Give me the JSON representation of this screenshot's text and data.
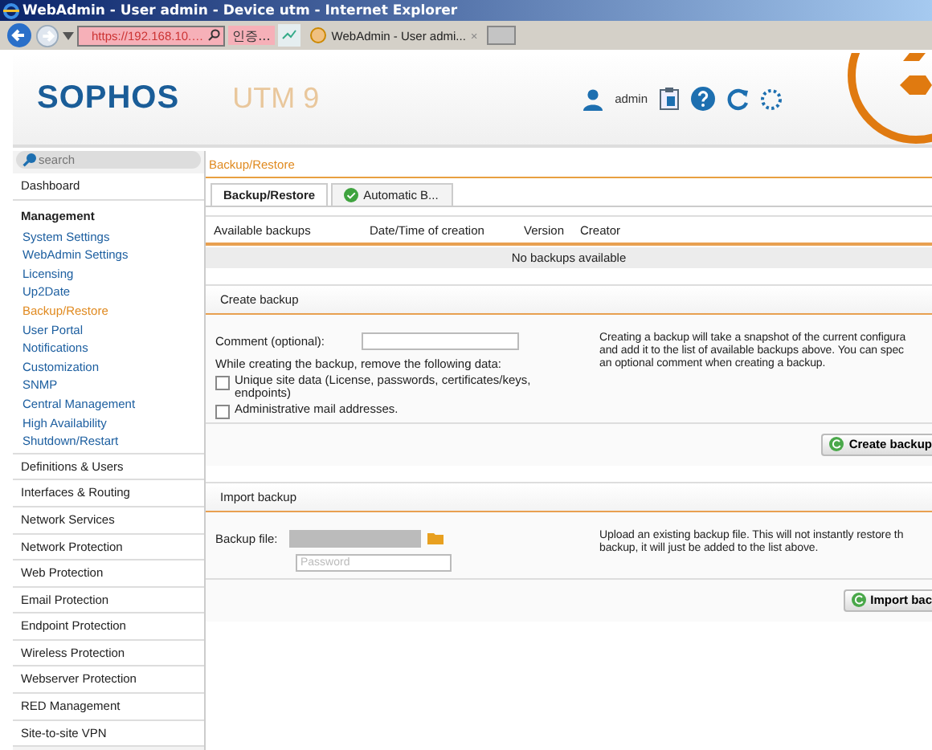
{
  "window": {
    "title": "WebAdmin - User admin - Device utm - Internet Explorer"
  },
  "browser": {
    "address": "https://192.168.10.…",
    "cert_warning": "인증...",
    "tab": "WebAdmin - User admi...",
    "tab_close": "×"
  },
  "header": {
    "logo": "SOPHOS",
    "product": "UTM 9",
    "user": "admin"
  },
  "sidebar": {
    "search_placeholder": "search",
    "items": [
      {
        "label": "Dashboard",
        "kind": "category"
      },
      {
        "label": "Management",
        "kind": "group",
        "children": [
          {
            "label": "System Settings",
            "selected": false
          },
          {
            "label": "WebAdmin Settings",
            "selected": false
          },
          {
            "label": "Licensing",
            "selected": false
          },
          {
            "label": "Up2Date",
            "selected": false
          },
          {
            "label": "Backup/Restore",
            "selected": true
          },
          {
            "label": "User Portal",
            "selected": false
          },
          {
            "label": "Notifications",
            "selected": false
          },
          {
            "label": "Customization",
            "selected": false
          },
          {
            "label": "SNMP",
            "selected": false
          },
          {
            "label": "Central Management",
            "selected": false
          },
          {
            "label": "High Availability",
            "selected": false
          },
          {
            "label": "Shutdown/Restart",
            "selected": false
          }
        ]
      },
      {
        "label": "Definitions & Users",
        "kind": "category"
      },
      {
        "label": "Interfaces & Routing",
        "kind": "category"
      },
      {
        "label": "Network Services",
        "kind": "category"
      },
      {
        "label": "Network Protection",
        "kind": "category"
      },
      {
        "label": "Web Protection",
        "kind": "category"
      },
      {
        "label": "Email Protection",
        "kind": "category"
      },
      {
        "label": "Endpoint Protection",
        "kind": "category"
      },
      {
        "label": "Wireless Protection",
        "kind": "category"
      },
      {
        "label": "Webserver Protection",
        "kind": "category"
      },
      {
        "label": "RED Management",
        "kind": "category"
      },
      {
        "label": "Site-to-site VPN",
        "kind": "category"
      }
    ]
  },
  "breadcrumb": "Backup/Restore",
  "tabs": [
    {
      "label": "Backup/Restore",
      "selected": true,
      "status_ok": false
    },
    {
      "label": "Automatic B...",
      "selected": false,
      "status_ok": true
    }
  ],
  "table": {
    "columns": [
      "Available backups",
      "Date/Time of creation",
      "Version",
      "Creator"
    ],
    "empty_text": "No backups available"
  },
  "create_backup": {
    "title": "Create backup",
    "comment_label": "Comment (optional):",
    "remove_label": "While creating the backup, remove the following data:",
    "options": [
      {
        "label": "Unique site data (License, passwords, certificates/keys, endpoints)",
        "checked": false
      },
      {
        "label": "Administrative mail addresses.",
        "checked": false
      }
    ],
    "help_lines": [
      "Creating a backup will take a snapshot of the current configura",
      "and add it to the list of available backups above. You can spec",
      "an optional comment when creating a backup."
    ],
    "button": "Create backup"
  },
  "import_backup": {
    "title": "Import backup",
    "file_label": "Backup file:",
    "password_placeholder": "Password",
    "help_lines": [
      "Upload an existing backup file. This will not instantly restore th",
      "backup, it will just be added to the list above."
    ],
    "button": "Import bac"
  }
}
